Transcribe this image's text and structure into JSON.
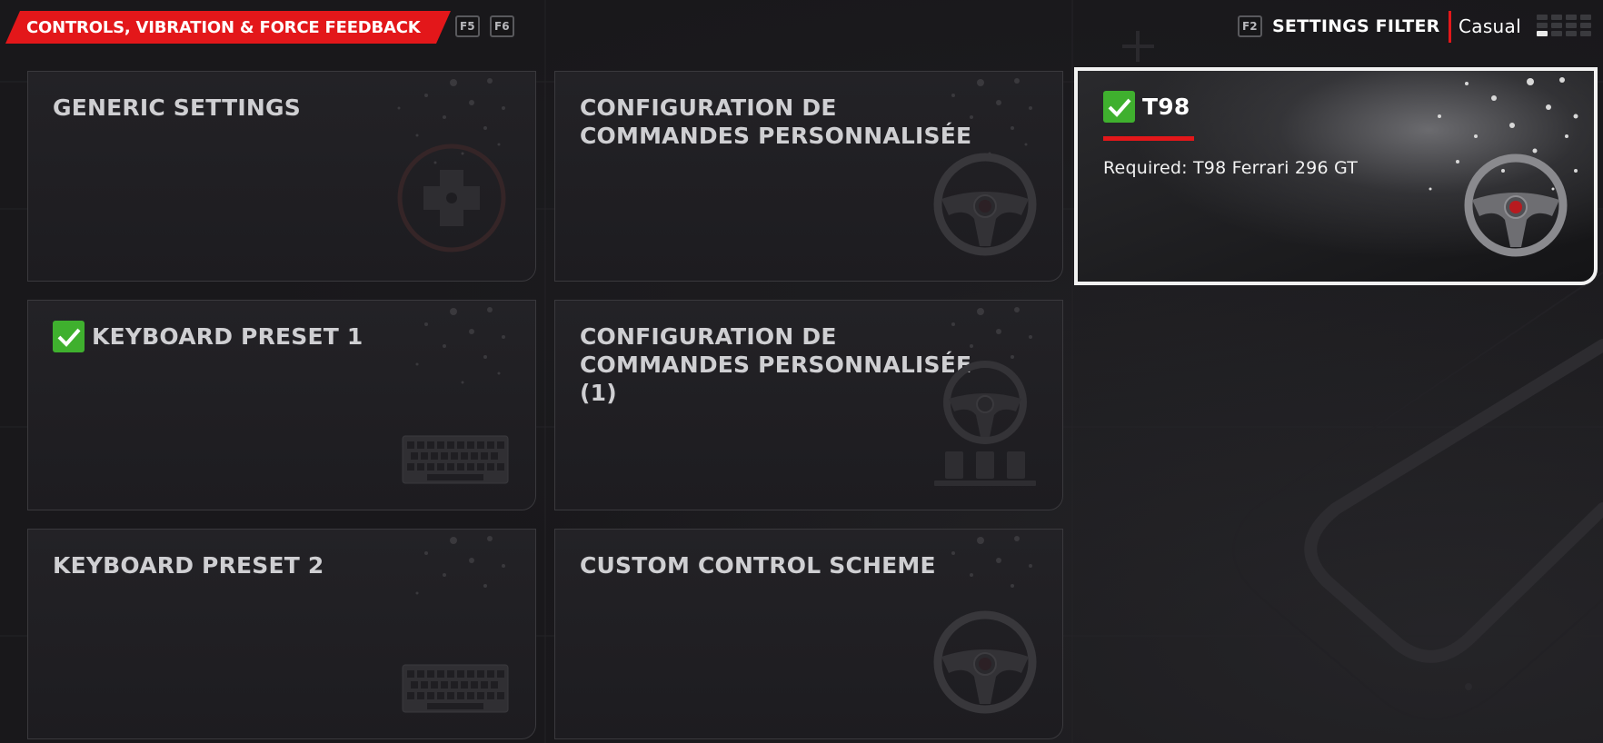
{
  "header": {
    "title": "CONTROLS, VIBRATION & FORCE FEEDBACK",
    "tab_prev_key": "F5",
    "tab_next_key": "F6",
    "filter_key": "F2",
    "filter_label": "SETTINGS FILTER",
    "filter_value": "Casual"
  },
  "cards": [
    {
      "title": "GENERIC SETTINGS",
      "checked": false,
      "icon": "gamepad-dpad-icon"
    },
    {
      "title": "CONFIGURATION DE COMMANDES PERSONNALISÉE",
      "checked": false,
      "icon": "steering-wheel-icon"
    },
    {
      "title": "T98",
      "checked": true,
      "selected": true,
      "subtext": "Required: T98 Ferrari 296 GT",
      "icon": "steering-wheel-icon"
    },
    {
      "title": "KEYBOARD PRESET 1",
      "checked": true,
      "icon": "keyboard-icon"
    },
    {
      "title": "CONFIGURATION DE COMMANDES PERSONNALISÉE (1)",
      "checked": false,
      "icon": "wheel-and-pedals-icon"
    },
    {
      "title": "KEYBOARD PRESET 2",
      "checked": false,
      "icon": "keyboard-icon"
    },
    {
      "title": "CUSTOM CONTROL SCHEME",
      "checked": false,
      "icon": "steering-wheel-icon"
    }
  ],
  "colors": {
    "accent_red": "#e3171a",
    "check_green": "#3fb02e",
    "background": "#19181b",
    "card_border": "#3a393d",
    "selected_border": "#f2f2f2"
  }
}
